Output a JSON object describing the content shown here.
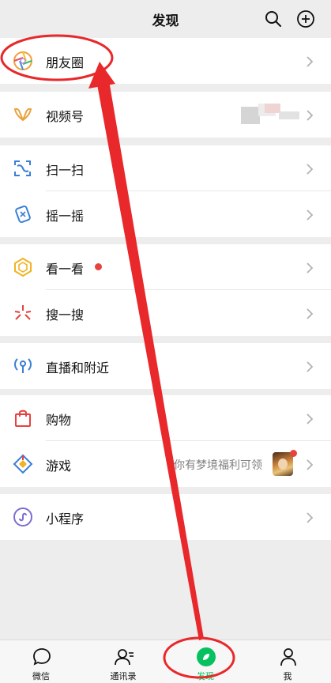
{
  "header": {
    "title": "发现",
    "search_icon": "search-icon",
    "add_icon": "plus-circle-icon"
  },
  "rows": {
    "moments": {
      "label": "朋友圈",
      "icon": "moments-icon"
    },
    "channels": {
      "label": "视频号",
      "icon": "channels-icon"
    },
    "scan": {
      "label": "扫一扫",
      "icon": "scan-icon"
    },
    "shake": {
      "label": "摇一摇",
      "icon": "shake-icon"
    },
    "top_stories": {
      "label": "看一看",
      "icon": "top-stories-icon"
    },
    "search": {
      "label": "搜一搜",
      "icon": "search-sparkle-icon"
    },
    "live_nearby": {
      "label": "直播和附近",
      "icon": "live-nearby-icon"
    },
    "shopping": {
      "label": "购物",
      "icon": "shopping-bag-icon"
    },
    "games": {
      "label": "游戏",
      "subtitle": "你有梦境福利可领",
      "icon": "games-icon"
    },
    "mini_programs": {
      "label": "小程序",
      "icon": "mini-program-icon"
    }
  },
  "tabbar": {
    "chats": {
      "label": "微信",
      "icon": "chat-bubble-icon"
    },
    "contacts": {
      "label": "通讯录",
      "icon": "contacts-icon"
    },
    "discover": {
      "label": "发现",
      "icon": "compass-icon"
    },
    "me": {
      "label": "我",
      "icon": "person-icon"
    }
  },
  "colors": {
    "background": "#ededed",
    "accent": "#07c160",
    "annotation": "#e8282a",
    "badge": "#e64340"
  }
}
